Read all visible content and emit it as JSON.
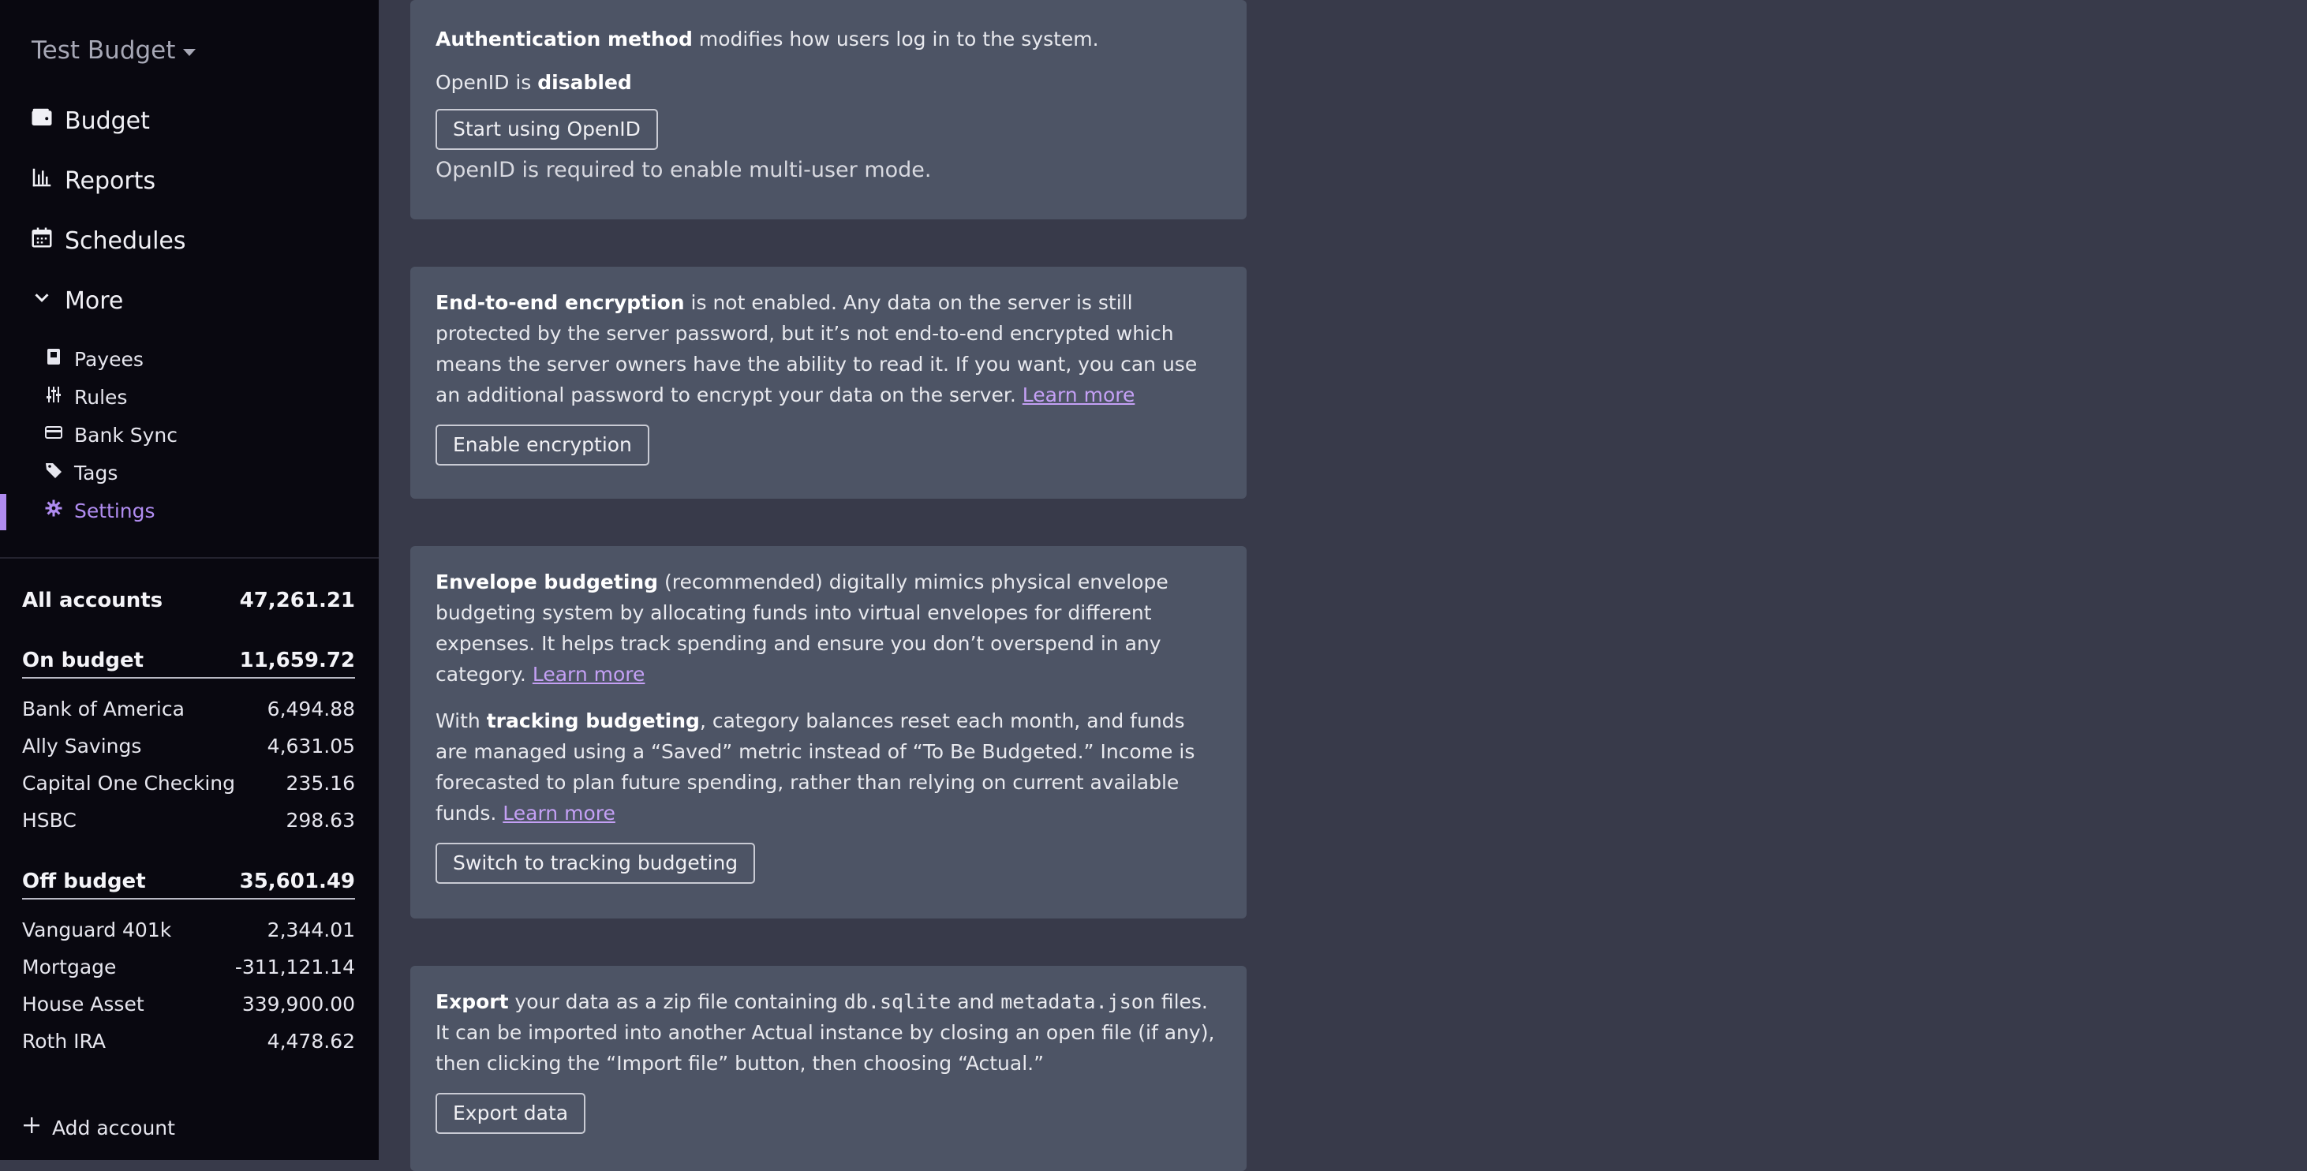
{
  "sidebar": {
    "budget_name": "Test Budget",
    "nav": [
      {
        "label": "Budget",
        "icon": "wallet-icon"
      },
      {
        "label": "Reports",
        "icon": "bar-chart-icon"
      },
      {
        "label": "Schedules",
        "icon": "calendar-icon"
      },
      {
        "label": "More",
        "icon": "chevron-down-icon"
      }
    ],
    "sub_nav": [
      {
        "label": "Payees",
        "icon": "payees-icon"
      },
      {
        "label": "Rules",
        "icon": "sliders-icon"
      },
      {
        "label": "Bank Sync",
        "icon": "credit-card-icon"
      },
      {
        "label": "Tags",
        "icon": "tag-icon"
      },
      {
        "label": "Settings",
        "icon": "gear-icon",
        "active": true
      }
    ],
    "accounts": {
      "all": {
        "label": "All accounts",
        "value": "47,261.21"
      },
      "on_budget": {
        "label": "On budget",
        "value": "11,659.72"
      },
      "on_budget_items": [
        {
          "label": "Bank of America",
          "value": "6,494.88"
        },
        {
          "label": "Ally Savings",
          "value": "4,631.05"
        },
        {
          "label": "Capital One Checking",
          "value": "235.16"
        },
        {
          "label": "HSBC",
          "value": "298.63"
        }
      ],
      "off_budget": {
        "label": "Off budget",
        "value": "35,601.49"
      },
      "off_budget_items": [
        {
          "label": "Vanguard 401k",
          "value": "2,344.01"
        },
        {
          "label": "Mortgage",
          "value": "-311,121.14"
        },
        {
          "label": "House Asset",
          "value": "339,900.00"
        },
        {
          "label": "Roth IRA",
          "value": "4,478.62"
        }
      ]
    },
    "add_account": "Add account",
    "accent_color": "#b08cf0"
  },
  "auth": {
    "bold": "Authentication method",
    "text": " modifies how users log in to the system.",
    "status_prefix": "OpenID is ",
    "status_value": "disabled",
    "button": "Start using OpenID",
    "note": "OpenID is required to enable multi-user mode."
  },
  "encryption": {
    "bold": "End-to-end encryption",
    "text": " is not enabled. Any data on the server is still protected by the server password, but it’s not end-to-end encrypted which means the server owners have the ability to read it. If you want, you can use an additional password to encrypt your data on the server. ",
    "link": "Learn more",
    "button": "Enable encryption"
  },
  "budgeting": {
    "bold1": "Envelope budgeting",
    "text1": " (recommended) digitally mimics physical envelope budgeting system by allocating funds into virtual envelopes for different expenses. It helps track spending and ensure you don’t overspend in any category. ",
    "link1": "Learn more",
    "prefix2": "With ",
    "bold2": "tracking budgeting",
    "text2": ", category balances reset each month, and funds are managed using a “Saved” metric instead of “To Be Budgeted.” Income is forecasted to plan future spending, rather than relying on current available funds. ",
    "link2": "Learn more",
    "button": "Switch to tracking budgeting"
  },
  "export": {
    "bold": "Export",
    "text1": " your data as a zip file containing ",
    "code1": "db.sqlite",
    "text2": " and ",
    "code2": "metadata.json",
    "text3": " files. It can be imported into another Actual instance by closing an open file (if any), then clicking the “Import file” button, then choosing “Actual.”",
    "button": "Export data"
  }
}
